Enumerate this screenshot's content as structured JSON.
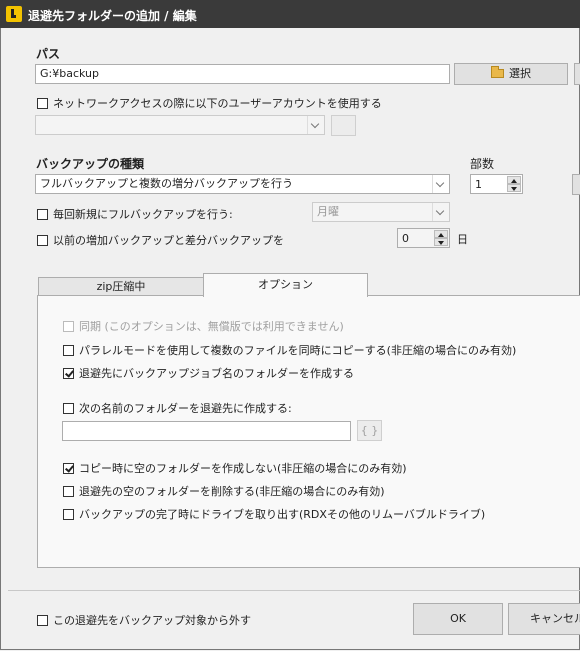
{
  "window": {
    "title": "退避先フォルダーの追加 / 編集"
  },
  "path_section": {
    "label": "パス",
    "value": "G:¥backup",
    "browse_label": "選択",
    "network_checkbox_label": "ネットワークアクセスの際に以下のユーザーアカウントを使用する",
    "network_checked": false,
    "account_value": ""
  },
  "backup_type": {
    "label": "バックアップの種類",
    "selected": "フルバックアップと複数の増分バックアップを行う",
    "copies_label": "部数",
    "copies_value": "1",
    "full_each_new_label": "毎回新規にフルバックアップを行う:",
    "full_each_new_checked": false,
    "weekday_value": "月曜",
    "prev_incr_label": "以前の増加バックアップと差分バックアップを",
    "prev_incr_checked": false,
    "days_value": "0",
    "days_unit": "日"
  },
  "tabs": [
    {
      "label": "zip圧縮中",
      "active": false
    },
    {
      "label": "オプション",
      "active": true
    }
  ],
  "options": {
    "sync_label": "同期 (このオプションは、無償版では利用できません)",
    "sync_checked": false,
    "parallel_label": "パラレルモードを使用して複数のファイルを同時にコピーする(非圧縮の場合にのみ有効)",
    "parallel_checked": false,
    "jobname_folder_label": "退避先にバックアップジョブ名のフォルダーを作成する",
    "jobname_folder_checked": true,
    "named_folder_label": "次の名前のフォルダーを退避先に作成する:",
    "named_folder_checked": false,
    "named_folder_value": "",
    "macro_button_label": "{ }",
    "no_empty_folder_label": "コピー時に空のフォルダーを作成しない(非圧縮の場合にのみ有効)",
    "no_empty_folder_checked": true,
    "delete_empty_label": "退避先の空のフォルダーを削除する(非圧縮の場合にのみ有効)",
    "delete_empty_checked": false,
    "eject_label": "バックアップの完了時にドライブを取り出す(RDXその他のリムーバブルドライブ)",
    "eject_checked": false
  },
  "footer": {
    "exclude_label": "この退避先をバックアップ対象から外す",
    "exclude_checked": false,
    "ok_label": "OK",
    "cancel_label": "キャンセル"
  }
}
